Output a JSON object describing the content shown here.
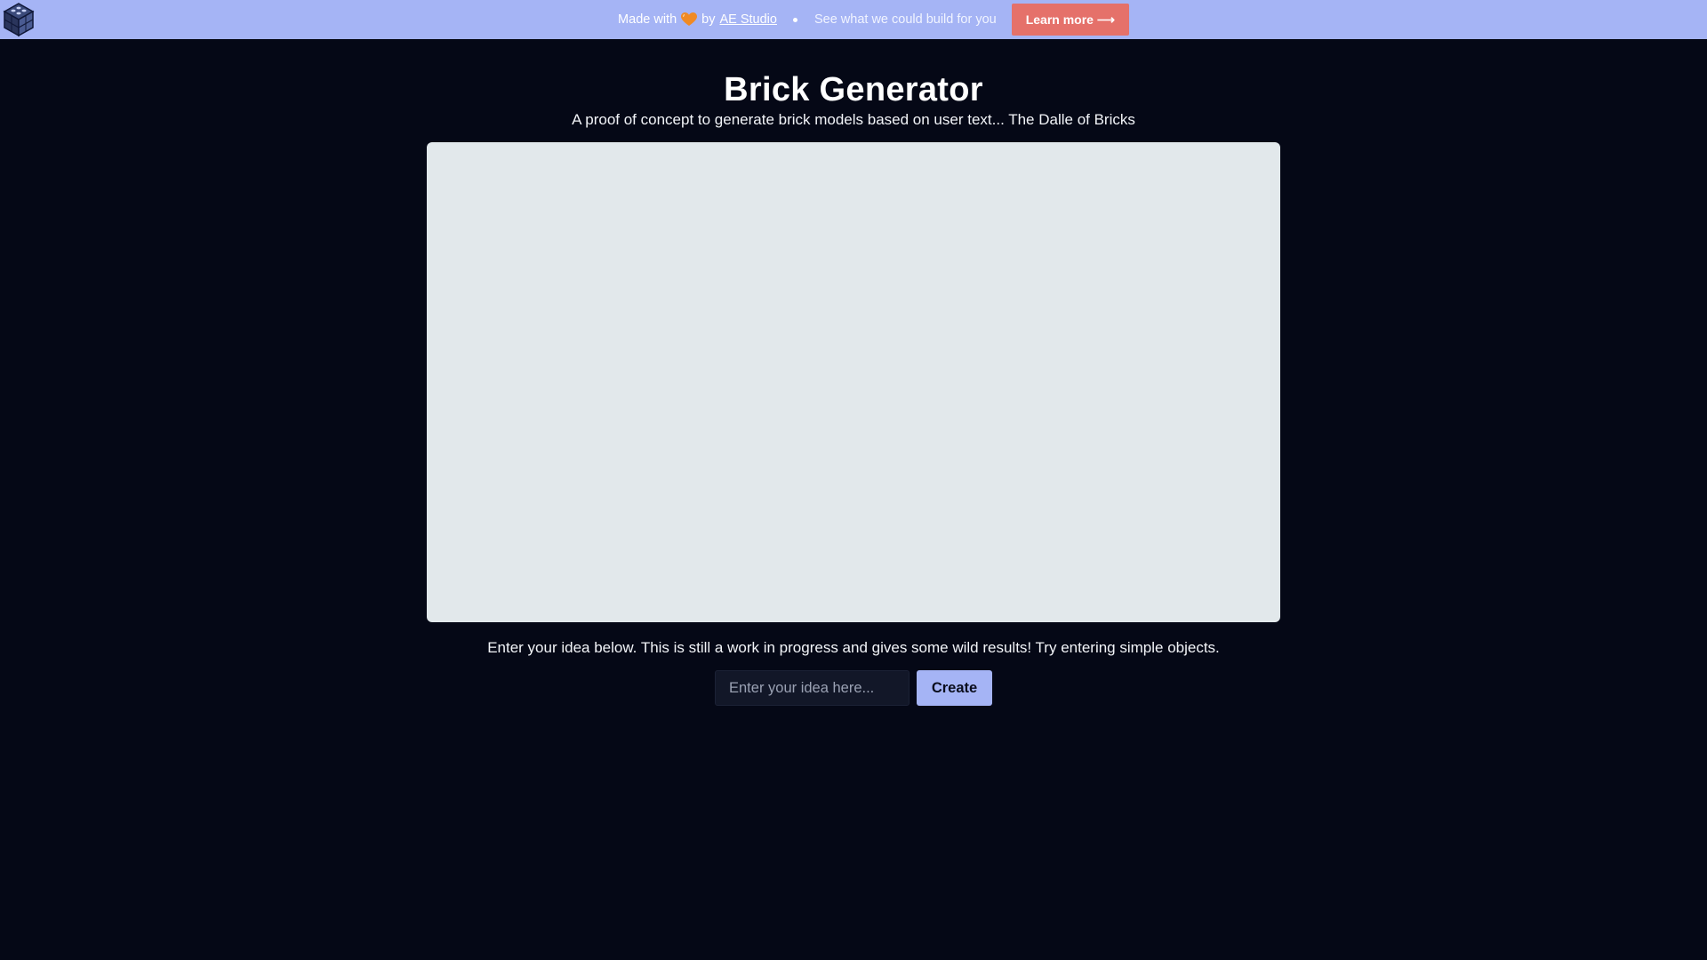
{
  "banner": {
    "logo_icon": "brick-cube-logo-icon",
    "made_with": "Made with",
    "heart_icon": "orange-heart-icon",
    "by": "by",
    "studio_link": "AE Studio",
    "tagline": "See what we could build for you",
    "learn_more": "Learn more ⟶"
  },
  "header": {
    "title": "Brick Generator",
    "subtitle": "A proof of concept to generate brick models based on user text... The Dalle of Bricks"
  },
  "main": {
    "instructions": "Enter your idea below. This is still a work in progress and gives some wild results! Try entering simple objects.",
    "input_placeholder": "Enter your idea here...",
    "input_value": "",
    "create_label": "Create"
  },
  "colors": {
    "banner_bg": "#a5b4f5",
    "page_bg": "#050816",
    "learn_btn_bg": "#e5716a",
    "viewer_bg": "#e2e8eb",
    "create_btn_bg": "#a5b4f5",
    "heart": "#f08a24"
  }
}
